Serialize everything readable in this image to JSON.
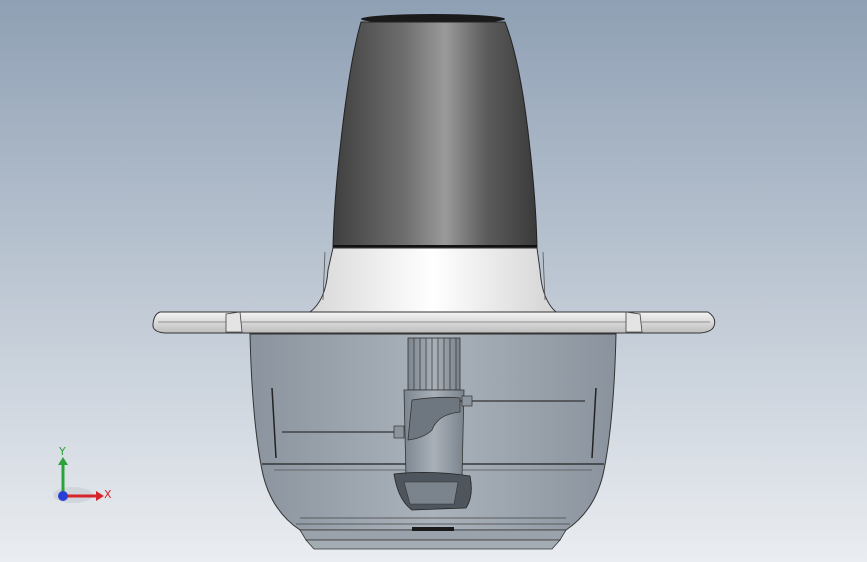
{
  "viewport": {
    "background_top": "#8fa0b4",
    "background_bottom": "#eaedf1"
  },
  "model": {
    "motor_housing_color": "#5a5a5a",
    "lid_color": "#f2f2f2",
    "bowl_color": "#9aa3ad"
  },
  "triad": {
    "x_label": "X",
    "y_label": "Y",
    "x_color": "#d6252b",
    "y_color": "#2aa33a",
    "z_color": "#2a3fd6"
  }
}
